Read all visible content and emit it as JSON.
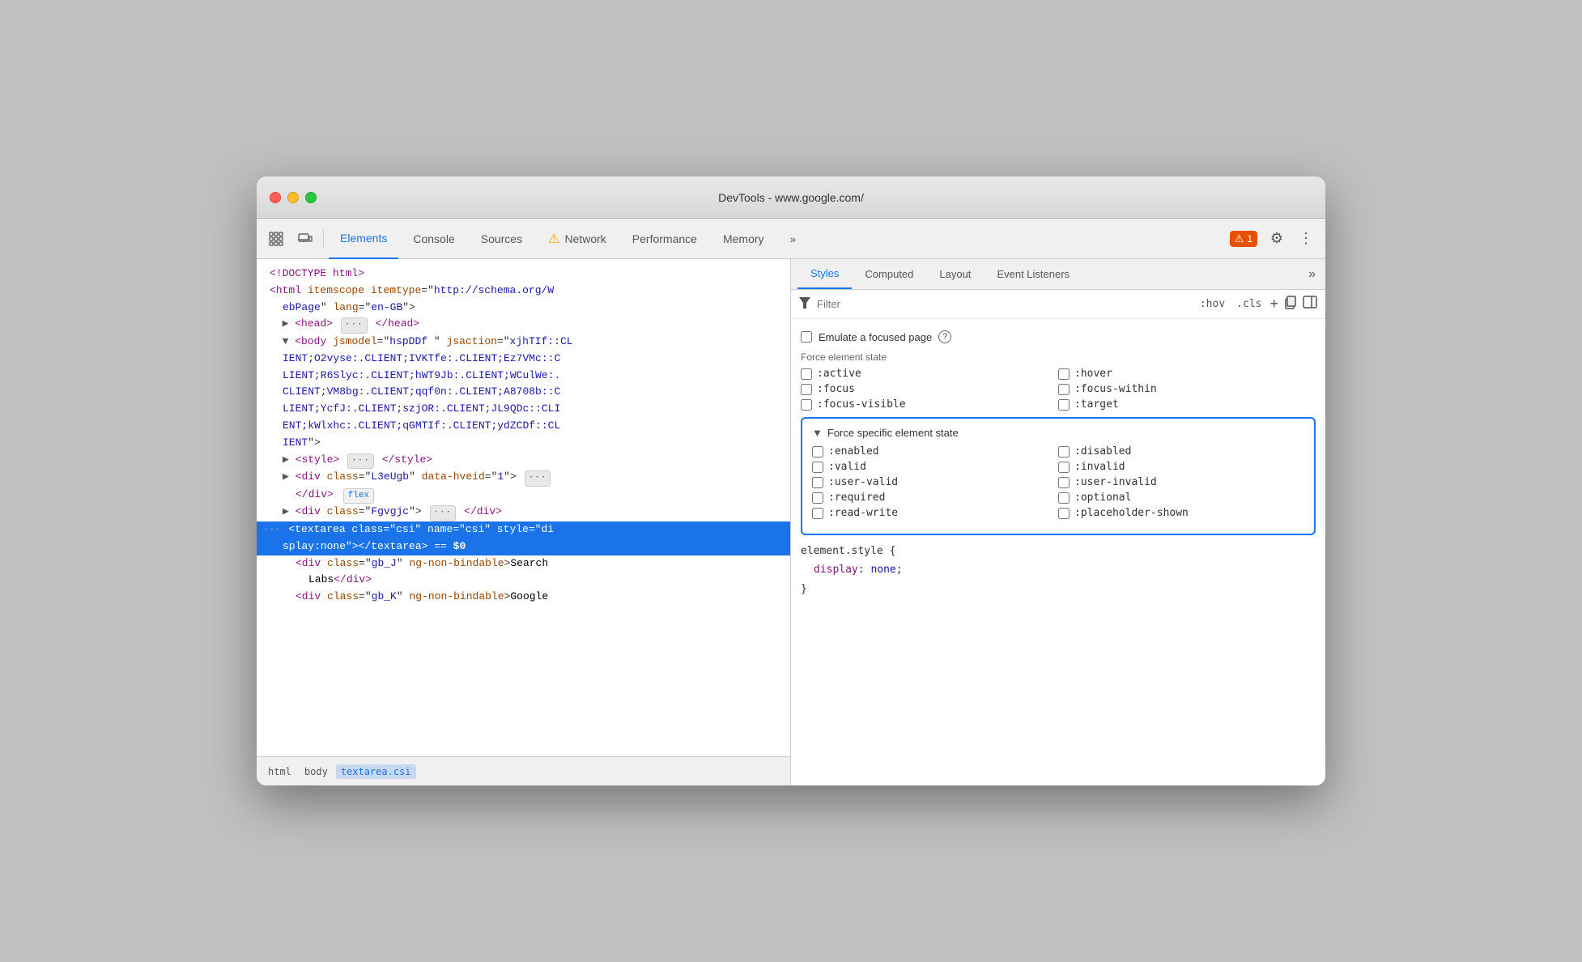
{
  "window": {
    "title": "DevTools - www.google.com/"
  },
  "toolbar": {
    "tabs": [
      {
        "id": "elements",
        "label": "Elements",
        "active": true
      },
      {
        "id": "console",
        "label": "Console",
        "active": false
      },
      {
        "id": "sources",
        "label": "Sources",
        "active": false
      },
      {
        "id": "network",
        "label": "Network",
        "active": false,
        "has_warning": true
      },
      {
        "id": "performance",
        "label": "Performance",
        "active": false
      },
      {
        "id": "memory",
        "label": "Memory",
        "active": false
      }
    ],
    "badge_count": "1",
    "more_tabs_icon": "»",
    "settings_icon": "⚙",
    "more_options_icon": "⋮"
  },
  "dom": {
    "lines": [
      {
        "text": "<!DOCTYPE html>",
        "type": "doctype",
        "indent": 0
      },
      {
        "text": "<html itemscope itemtype=\"http://schema.org/W",
        "type": "tag",
        "indent": 0,
        "has_expand": false
      },
      {
        "text": "ebPage\" lang=\"en-GB\">",
        "type": "continuation",
        "indent": 1
      },
      {
        "text": "▶ <head> ··· </head>",
        "type": "tag",
        "indent": 1,
        "has_arrow": true
      },
      {
        "text": "▼ <body jsmodel=\"hspDDf \" jsaction=\"xjhTIf::CL",
        "type": "tag",
        "indent": 1
      },
      {
        "text": "IENT;O2vyse:.CLIENT;IVKTfe:.CLIENT;Ez7VMc::C",
        "type": "continuation"
      },
      {
        "text": "LIENT;R6Slyc:.CLIENT;hWT9Jb:.CLIENT;WCulWe:.",
        "type": "continuation"
      },
      {
        "text": "CLIENT;VM8bg:.CLIENT;qqf0n:.CLIENT;A8708b::C",
        "type": "continuation"
      },
      {
        "text": "LIENT;YcfJ:.CLIENT;szjOR:.CLIENT;JL9QDc::CLI",
        "type": "continuation"
      },
      {
        "text": "ENT;kWlxhc:.CLIENT;qGMTIf:.CLIENT;ydZCDf::CL",
        "type": "continuation"
      },
      {
        "text": "IENT\">",
        "type": "continuation"
      },
      {
        "text": "▶ <style> ··· </style>",
        "type": "tag",
        "indent": 2,
        "has_arrow": true
      },
      {
        "text": "▶ <div class=\"L3eUgb\" data-hveid=\"1\"> ···",
        "type": "tag",
        "indent": 2,
        "has_arrow": true
      },
      {
        "text": "</div>  flex",
        "type": "tag-close",
        "indent": 3,
        "has_flex": true
      },
      {
        "text": "▶ <div class=\"Fgvgjc\"> ··· </div>",
        "type": "tag",
        "indent": 2,
        "has_arrow": true
      },
      {
        "text": "···  <textarea class=\"csi\" name=\"csi\" style=\"di",
        "type": "selected",
        "indent": 2
      },
      {
        "text": "splay:none\"></textarea> == $0",
        "type": "selected-continuation"
      },
      {
        "text": "<div class=\"gb_J\" ng-non-bindable>Search",
        "type": "tag",
        "indent": 3
      },
      {
        "text": "Labs</div>",
        "type": "tag-close",
        "indent": 4
      },
      {
        "text": "<div class=\"gb_K\" ng-non-bindable>Google",
        "type": "tag",
        "indent": 3
      }
    ]
  },
  "breadcrumb": {
    "items": [
      "html",
      "body",
      "textarea.csi"
    ]
  },
  "styles": {
    "tabs": [
      "Styles",
      "Computed",
      "Layout",
      "Event Listeners"
    ],
    "active_tab": "Styles",
    "more_icon": "»",
    "filter": {
      "placeholder": "Filter",
      "label": "Filter"
    },
    "controls": {
      "hov": ":hov",
      "cls": ".cls"
    },
    "emulate_focused_page": "Emulate a focused page",
    "force_element_state": "Force element state",
    "force_specific_element_state": "Force specific element state",
    "element_states": [
      {
        "id": "active",
        "label": ":active"
      },
      {
        "id": "focus",
        "label": ":focus"
      },
      {
        "id": "focus-visible",
        "label": ":focus-visible"
      }
    ],
    "element_states_right": [
      {
        "id": "hover",
        "label": ":hover"
      },
      {
        "id": "focus-within",
        "label": ":focus-within"
      },
      {
        "id": "target",
        "label": ":target"
      }
    ],
    "specific_states_left": [
      {
        "id": "enabled",
        "label": ":enabled"
      },
      {
        "id": "valid",
        "label": ":valid"
      },
      {
        "id": "user-valid",
        "label": ":user-valid"
      },
      {
        "id": "required",
        "label": ":required"
      },
      {
        "id": "read-write",
        "label": ":read-write"
      }
    ],
    "specific_states_right": [
      {
        "id": "disabled",
        "label": ":disabled"
      },
      {
        "id": "invalid",
        "label": ":invalid"
      },
      {
        "id": "user-invalid",
        "label": ":user-invalid"
      },
      {
        "id": "optional",
        "label": ":optional"
      },
      {
        "id": "placeholder-shown",
        "label": ":placeholder-shown"
      }
    ],
    "css_block": {
      "selector": "element.style {",
      "property": "display",
      "value": "none",
      "close": "}"
    }
  }
}
